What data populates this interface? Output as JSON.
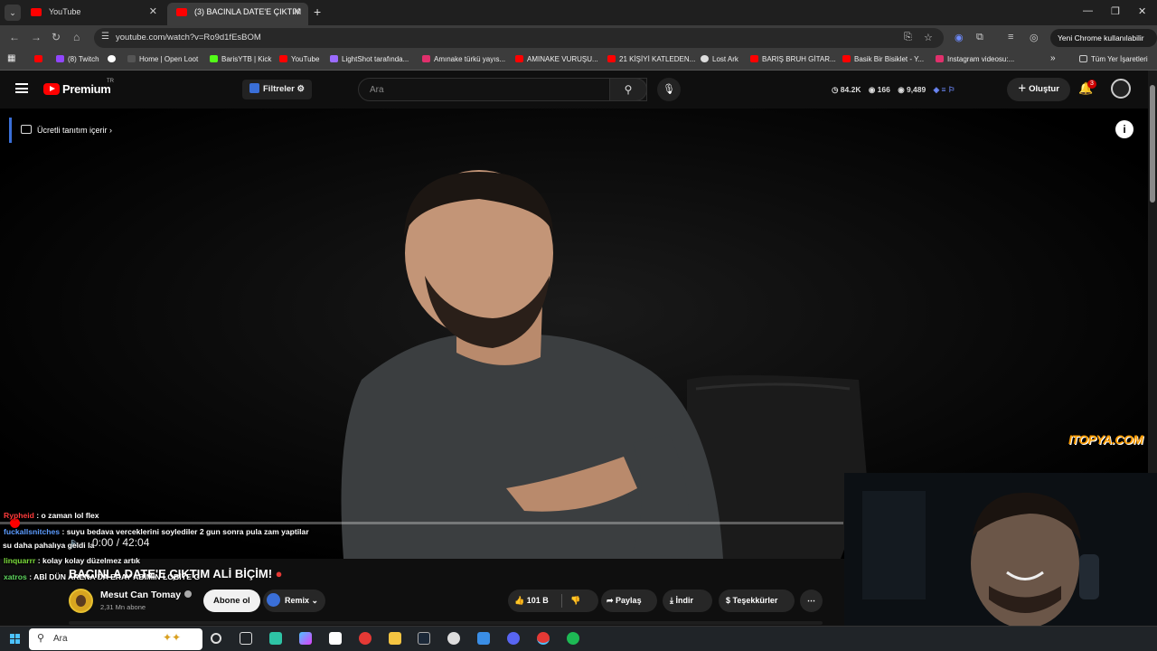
{
  "tabs": [
    {
      "title": "YouTube",
      "close": "✕"
    },
    {
      "title": "(3) BACINLA DATE'E ÇIKTIM",
      "close": "✕"
    }
  ],
  "new_tab": "+",
  "window_controls": {
    "minimize": "—",
    "restore": "❐",
    "close": "✕"
  },
  "address_bar": {
    "url": "youtube.com/watch?v=Ro9d1fEsBOM"
  },
  "chrome_user": "Yeni Chrome kullanılabilir",
  "bookmarks": [
    "(8) Twitch",
    "",
    "Home | Open Loot",
    "BarisYTB | Kick",
    "YouTube",
    "LightShot tarafında...",
    "Amınake türkü yayıs...",
    "AMINAKE VURUŞU...",
    "21 KİŞİYİ KATLEDEN...",
    "Lost Ark",
    "BARIŞ BRUH GİTAR...",
    "Basik Bir Bisiklet - Y...",
    "Instagram videosu:..."
  ],
  "bookmarks_overflow": "»",
  "all_bookmarks": "Tüm Yer İşaretleri",
  "yt": {
    "logo_text": "Premium",
    "country": "TR",
    "filters_label": "Filtreler",
    "search_placeholder": "Ara",
    "stats": {
      "views": "84.2K",
      "eye": "166",
      "subs": "9,489"
    },
    "create_label": "Oluştur",
    "notif_count": "3"
  },
  "video": {
    "paid_promo": "Ücretli tanıtım içerir",
    "info_icon": "i",
    "watermark": "ITOPYA.COM",
    "time": "0:00 / 42:04",
    "progress": 0.0
  },
  "chat": [
    {
      "user": "Rypheid",
      "msg": ": o zaman lol flex",
      "color": "#ff3b3b"
    },
    {
      "user": "fuckallsnitches",
      "msg": ": suyu bedava verceklerini soylediler 2 gun sonra pula zam yaptilar",
      "color": "#5b9bff"
    },
    {
      "user": "",
      "msg": "su daha pahalıya geldi la",
      "color": "#ffffff"
    },
    {
      "user": "linquarrr",
      "msg": ": kolay kolay düzelmez artık",
      "color": "#7bdc3a"
    },
    {
      "user": "xatros",
      "msg": ": ABİ DÜN ARENA'DA ERAY ABİMİN LOBİYE G",
      "color": "#5fd65f"
    }
  ],
  "video_title": "BACINLA DATE'E ÇIKTIM ALİ BİÇİM!",
  "channel": {
    "name": "Mesut Can Tomay",
    "subs": "2,31 Mn abone"
  },
  "actions": {
    "subscribe": "Abone ol",
    "remix": "Remix",
    "likes": "101 B",
    "share": "Paylaş",
    "download": "İndir",
    "thanks": "Teşekkürler",
    "more": "⋯"
  },
  "taskbar": {
    "search_placeholder": "Ara"
  },
  "colors": {
    "yt_red": "#ff0000",
    "accent_blue": "#3a6fd8",
    "bg": "#0f0f0f"
  }
}
